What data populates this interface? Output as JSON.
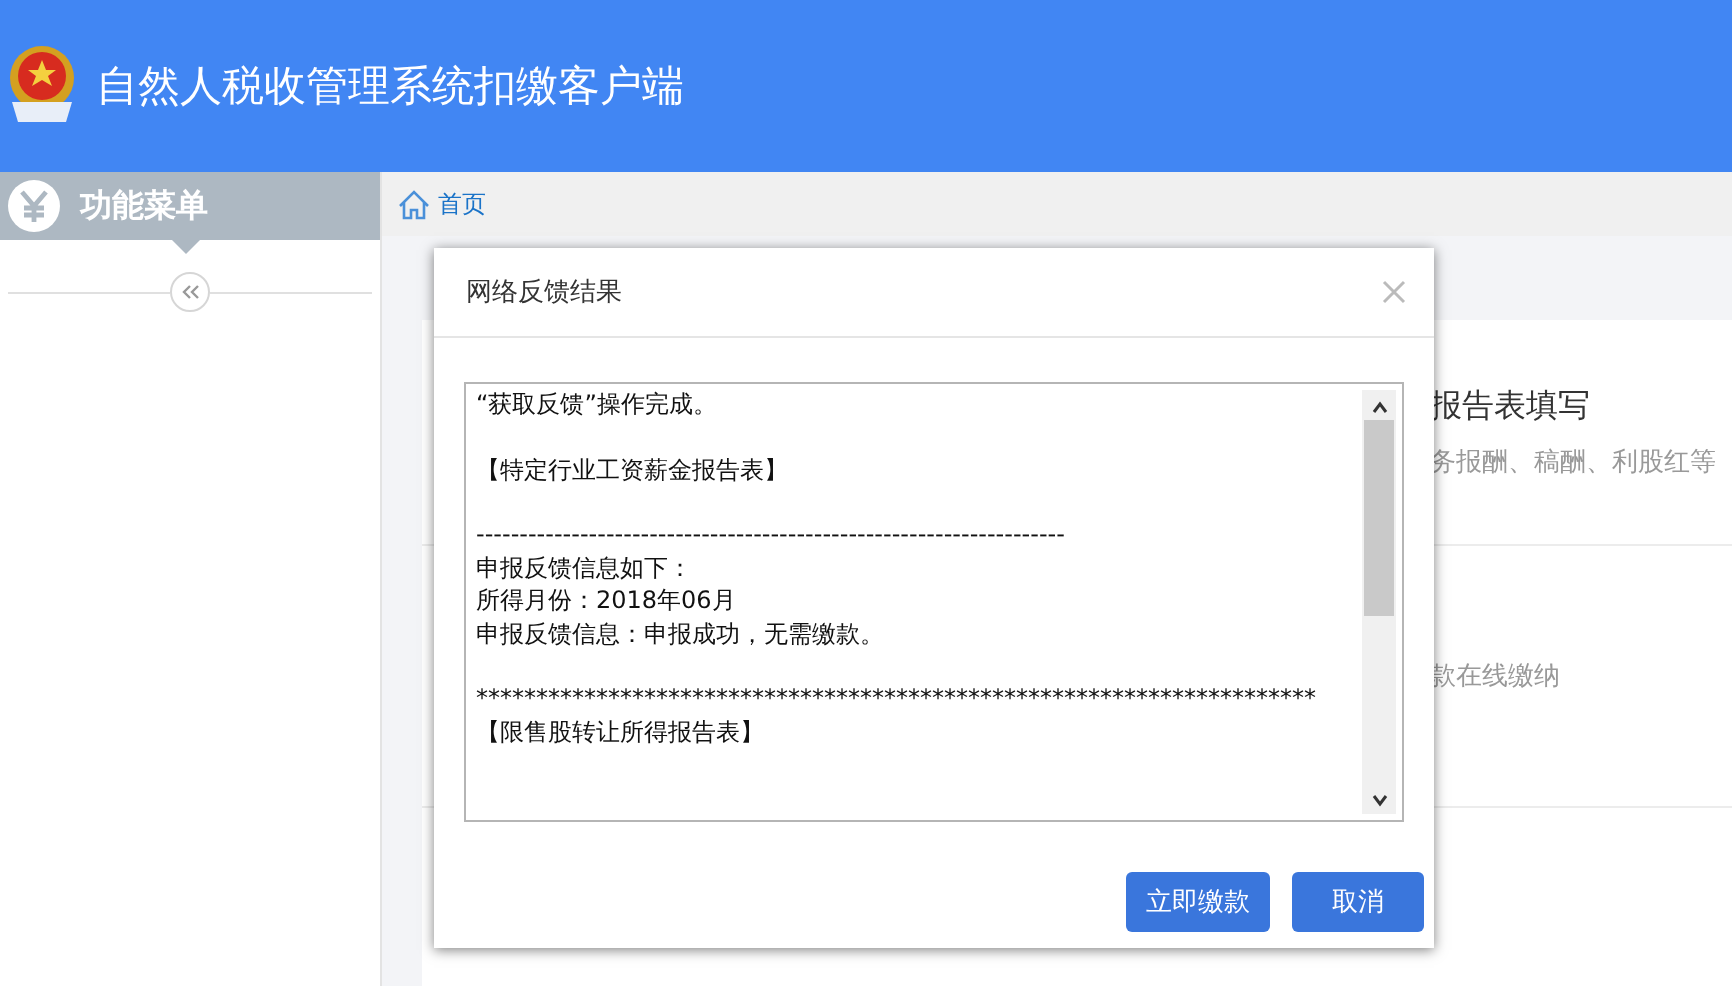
{
  "header": {
    "title": "自然人税收管理系统扣缴客户端"
  },
  "sidebar": {
    "title": "功能菜单"
  },
  "breadcrumb": {
    "label": "首页"
  },
  "cards": [
    {
      "title": "报告表填写",
      "description": "务报酬、稿酬、利股红等"
    },
    {
      "description": "款在线缴纳"
    }
  ],
  "dialog": {
    "title": "网络反馈结果",
    "message_blocks": [
      [
        "“获取反馈”操作完成。"
      ],
      [
        "【特定行业工资薪金报告表】"
      ],
      [
        "--------------------------------------------------------------------",
        "申报反馈信息如下：",
        "所得月份：2018年06月",
        "申报反馈信息：申报成功，无需缴款。"
      ],
      [
        "**********************************************************************",
        "【限售股转让所得报告表】"
      ]
    ],
    "buttons": [
      {
        "label": "立即缴款"
      },
      {
        "label": "取消"
      }
    ]
  }
}
